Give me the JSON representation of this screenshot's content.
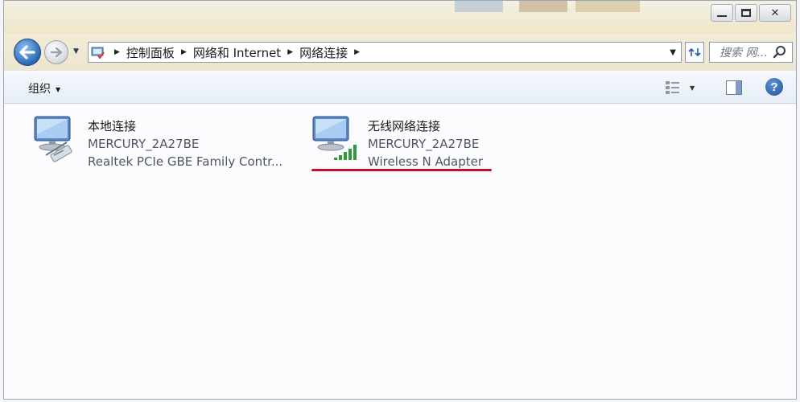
{
  "window": {
    "minimize_label": "",
    "maximize_label": "",
    "close_label": "✕"
  },
  "address": {
    "crumbs": [
      "控制面板",
      "网络和 Internet",
      "网络连接"
    ]
  },
  "search": {
    "placeholder": "搜索 网..."
  },
  "toolbar": {
    "organize_label": "组织"
  },
  "connections": [
    {
      "name": "本地连接",
      "network": "MERCURY_2A27BE",
      "adapter": "Realtek PCIe GBE Family Contr..."
    },
    {
      "name": "无线网络连接",
      "network": "MERCURY_2A27BE",
      "adapter": "Wireless N Adapter"
    }
  ],
  "colors": {
    "annotation": "#c8102e",
    "signal": "#2e9a3a"
  },
  "icons": {
    "back": "back-arrow-icon",
    "forward": "forward-arrow-icon",
    "search": "search-icon",
    "refresh": "refresh-icon",
    "views": "views-icon",
    "preview_pane": "preview-pane-icon",
    "help": "help-icon",
    "wired": "wired-network-icon",
    "wireless": "wireless-network-icon"
  }
}
